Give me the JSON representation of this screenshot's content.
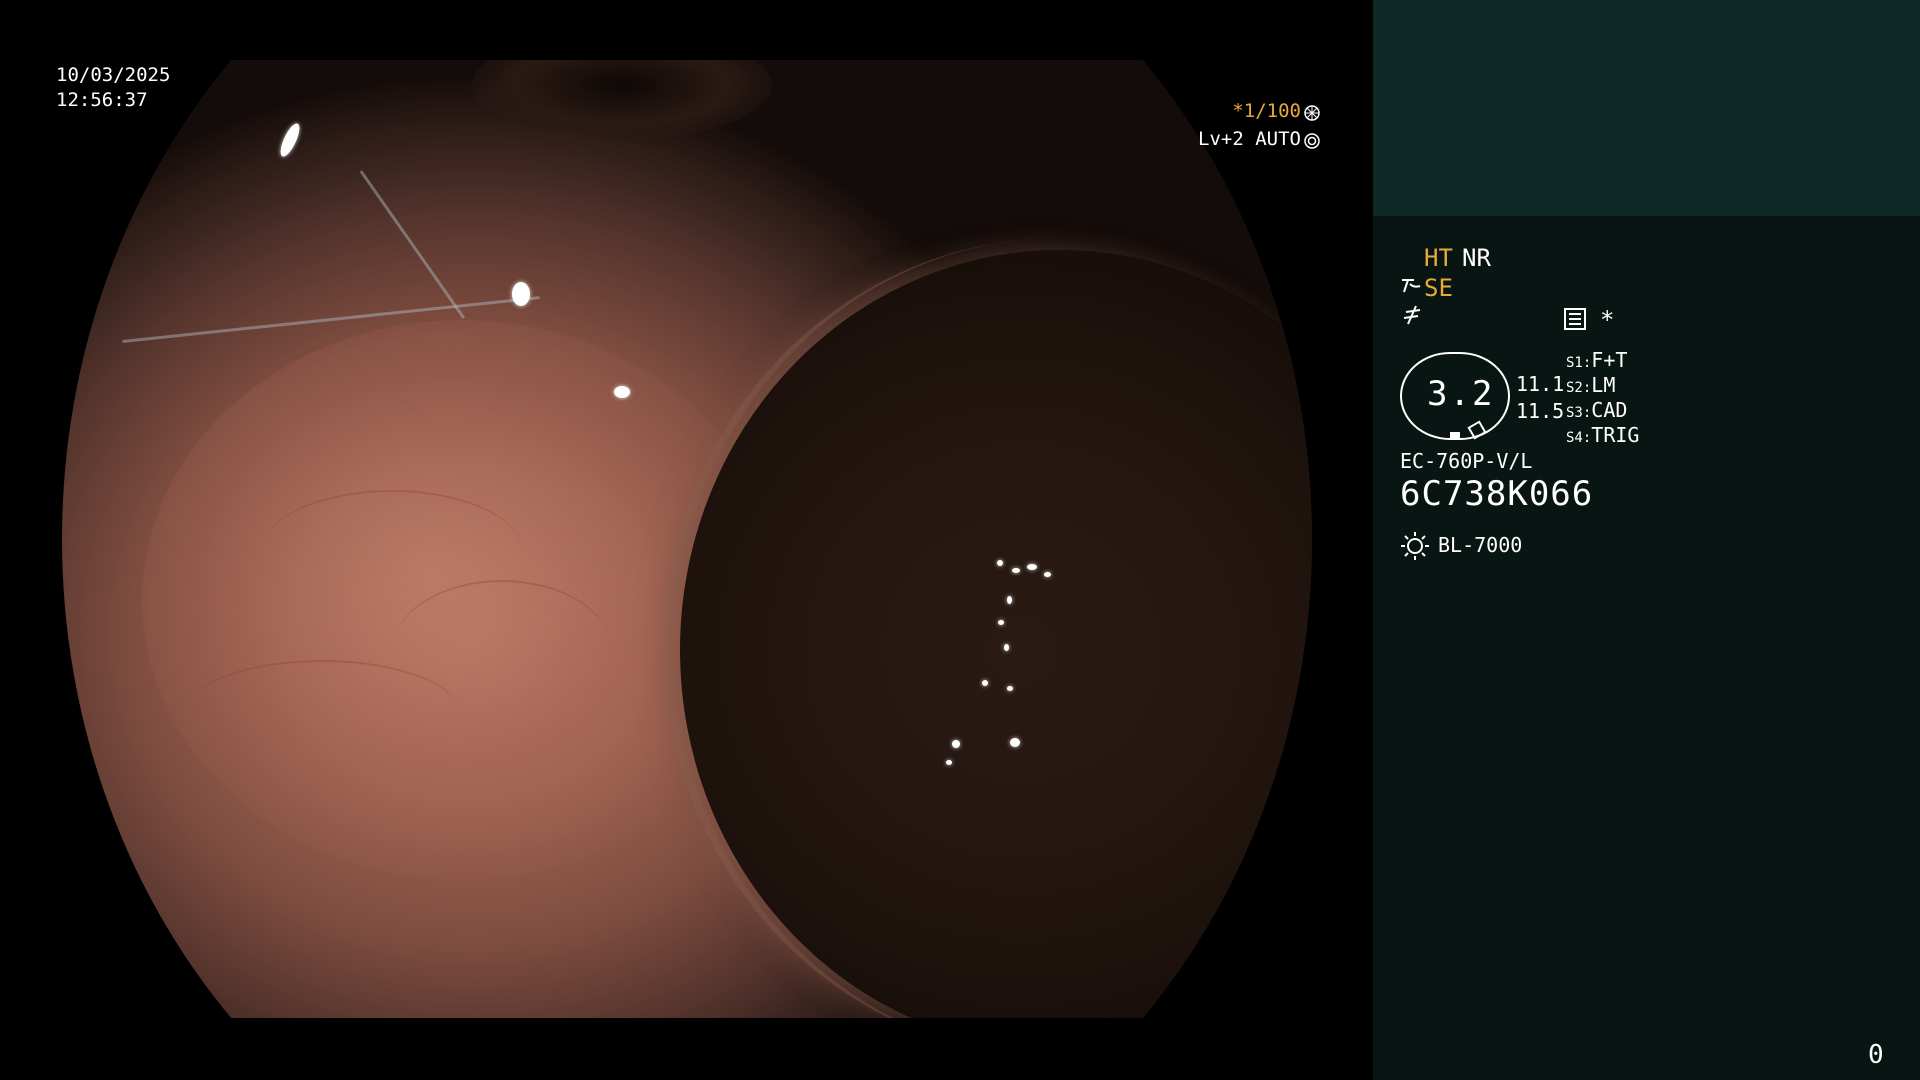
{
  "overlay": {
    "date": "10/03/2025",
    "time": "12:56:37",
    "shutter": "*1/100",
    "iris": "Lv+2 AUTO"
  },
  "panel": {
    "ht": "HT",
    "nr": "NR",
    "se": "SE",
    "asterisk": "*",
    "zoom": "3.2",
    "value_1": "11.1",
    "value_2": "11.5",
    "switches": [
      {
        "key": "S1:",
        "value": "F+T"
      },
      {
        "key": "S2:",
        "value": "LM"
      },
      {
        "key": "S3:",
        "value": "CAD"
      },
      {
        "key": "S4:",
        "value": "TRIG"
      }
    ],
    "scope_model": "EC-760P-V/L",
    "scope_serial": "6C738K066",
    "light_source": "BL-7000",
    "counter": "0"
  },
  "colors": {
    "highlight": "#e8a93a",
    "panel_top": "#0e2826",
    "panel_bottom": "#081513",
    "text": "#ffffff"
  },
  "icons": {
    "shutter": "shutter-icon",
    "iris": "iris-icon",
    "se": "structure-icon",
    "flash": "flash-icon",
    "menu": "menu-list-icon",
    "light": "sun-icon"
  }
}
